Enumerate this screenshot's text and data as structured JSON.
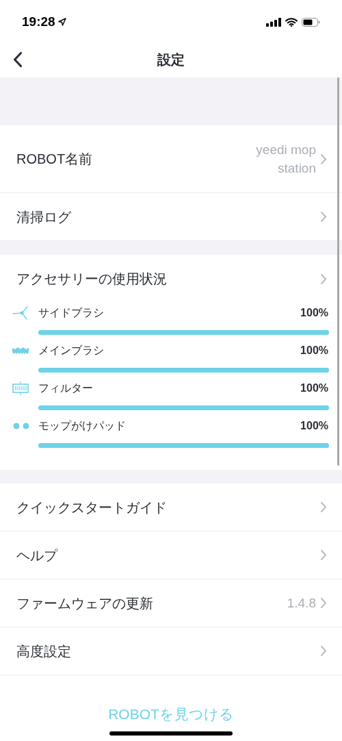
{
  "status_bar": {
    "time": "19:28"
  },
  "nav": {
    "title": "設定"
  },
  "group_1": [
    {
      "label": "ROBOT名前",
      "value": "yeedi mop station"
    },
    {
      "label": "清掃ログ"
    }
  ],
  "accessories": {
    "header": "アクセサリーの使用状況",
    "items": [
      {
        "kind": "side-brush",
        "name": "サイドブラシ",
        "reading": "100%",
        "level": 1
      },
      {
        "kind": "main-brush",
        "name": "メインブラシ",
        "reading": "100%",
        "level": 1
      },
      {
        "kind": "filter",
        "name": "フィルター",
        "reading": "100%",
        "level": 1
      },
      {
        "kind": "mop-pad",
        "name": "モップがけパッド",
        "reading": "100%",
        "level": 1
      }
    ]
  },
  "group_2": [
    {
      "label": "クイックスタートガイド"
    },
    {
      "label": "ヘルプ"
    },
    {
      "label": "ファームウェアの更新",
      "value": "1.4.8"
    },
    {
      "label": "高度設定"
    }
  ],
  "footer_link": "ROBOTを見つける"
}
